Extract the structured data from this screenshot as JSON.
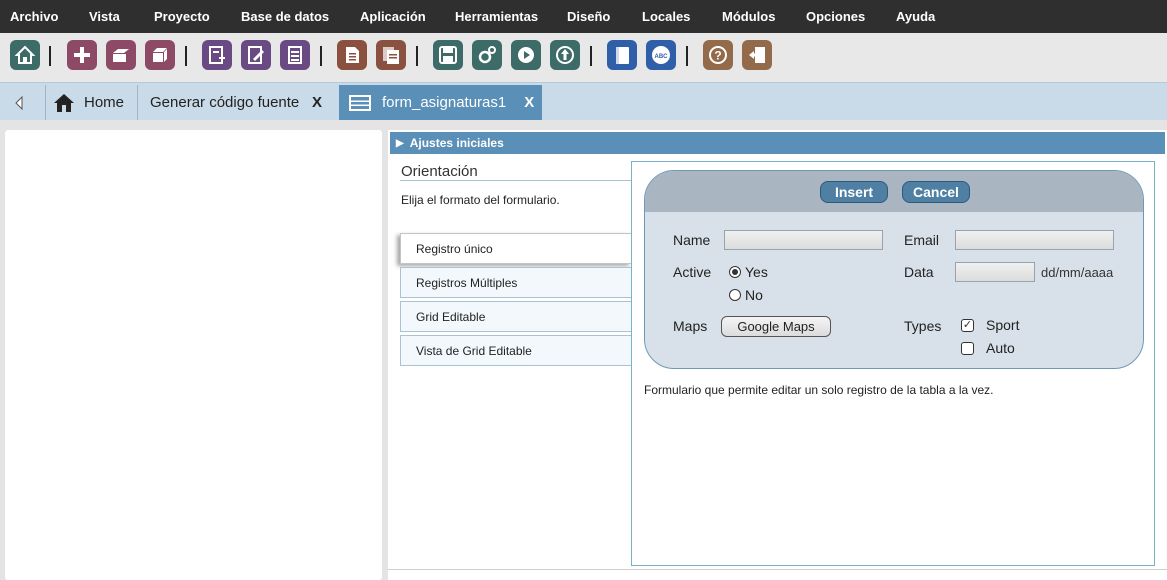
{
  "menu": [
    "Archivo",
    "Vista",
    "Proyecto",
    "Base de datos",
    "Aplicación",
    "Herramientas",
    "Diseño",
    "Locales",
    "Módulos",
    "Opciones",
    "Ayuda"
  ],
  "toolbar": {
    "colors": {
      "home": "#3d6b68",
      "project": "#8c4a66",
      "apps": "#6a4a82",
      "docs": "#8a5040",
      "tools": "#3d6b68",
      "help_blue": "#2f5fa8",
      "help_brown": "#946b4a"
    },
    "icons": [
      "home-icon",
      "new-icon",
      "open-project-icon",
      "close-project-icon",
      "new-app-icon",
      "edit-app-icon",
      "list-apps-icon",
      "document-icon",
      "copy-document-icon",
      "save-icon",
      "generate-icon",
      "run-icon",
      "publish-icon",
      "manual-icon",
      "spellcheck-icon",
      "help-icon",
      "exit-icon"
    ]
  },
  "tabs": {
    "home": "Home",
    "generate": "Generar código fuente",
    "form": "form_asignaturas1",
    "close": "X"
  },
  "section": {
    "title": "Ajustes iniciales"
  },
  "orientation": {
    "title": "Orientación",
    "description": "Elija el formato del formulario.",
    "options": [
      "Registro único",
      "Registros Múltiples",
      "Grid Editable",
      "Vista de Grid Editable"
    ],
    "selected": "Registro único"
  },
  "preview": {
    "insert": "Insert",
    "cancel": "Cancel",
    "name_label": "Name",
    "email_label": "Email",
    "active_label": "Active",
    "yes": "Yes",
    "no": "No",
    "data_label": "Data",
    "date_format": "dd/mm/aaaa",
    "maps_label": "Maps",
    "maps_button": "Google Maps",
    "types_label": "Types",
    "sport": "Sport",
    "auto": "Auto",
    "description": "Formulario que permite editar un solo registro de la tabla a la vez."
  }
}
